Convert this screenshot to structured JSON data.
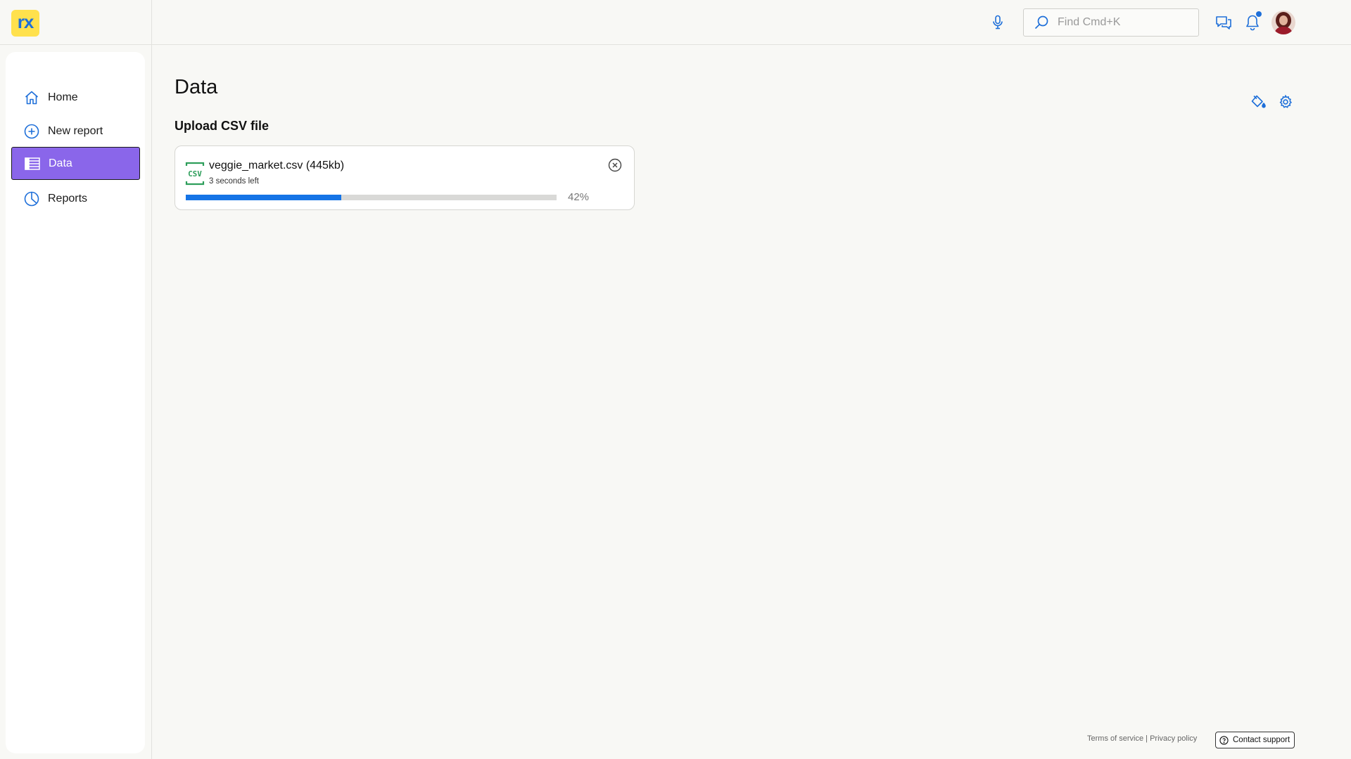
{
  "app": {
    "logo_text": "rx",
    "brand_colors": {
      "logo_bg": "#ffe14d",
      "logo_fg": "#1e6fd9",
      "accent": "#1574e6",
      "active_nav": "#8a66ea"
    }
  },
  "header": {
    "search": {
      "placeholder": "Find Cmd+K",
      "value": ""
    },
    "icons": [
      "microphone-icon",
      "search-icon",
      "chat-icon",
      "bell-icon",
      "avatar"
    ],
    "has_notification": true
  },
  "sidebar": {
    "items": [
      {
        "label": "Home",
        "icon": "home-icon",
        "active": false
      },
      {
        "label": "New report",
        "icon": "plus-circle-icon",
        "active": false
      },
      {
        "label": "Data",
        "icon": "table-icon",
        "active": true
      },
      {
        "label": "Reports",
        "icon": "pie-chart-icon",
        "active": false
      }
    ]
  },
  "main": {
    "title": "Data",
    "section_title": "Upload CSV file",
    "upload": {
      "file_label": "veggie_market.csv (445kb)",
      "time_left": "3 seconds left",
      "progress_text": "42%",
      "progress_fraction": 0.42,
      "file_icon_text": "CSV"
    }
  },
  "footer": {
    "terms": "Terms of service",
    "separator": "|",
    "privacy": "Privacy policy",
    "contact": "Contact support"
  }
}
